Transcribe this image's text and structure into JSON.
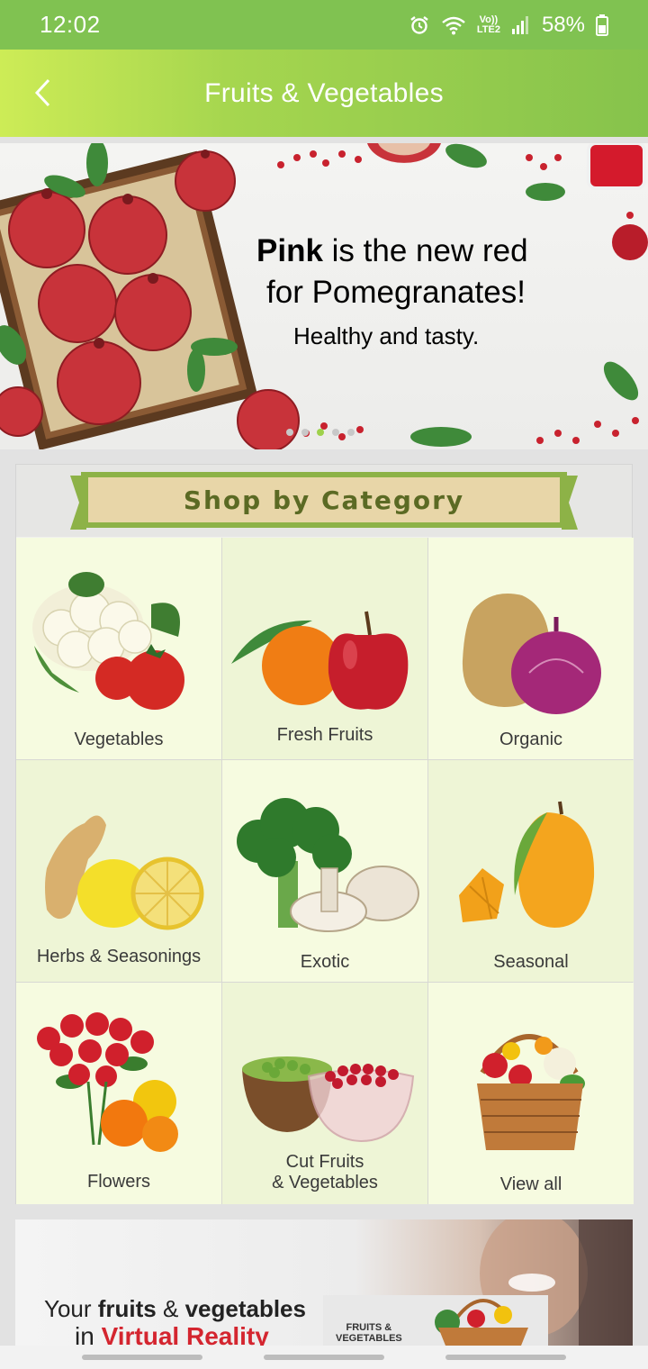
{
  "status_bar": {
    "time": "12:02",
    "network_label_top": "Vo))",
    "network_label_bottom": "LTE2",
    "battery": "58%",
    "icons": [
      "alarm-icon",
      "wifi-icon",
      "signal-icon",
      "battery-icon"
    ]
  },
  "app_bar": {
    "title": "Fruits & Vegetables",
    "back_icon": "chevron-left-icon"
  },
  "banner": {
    "line1_bold": "Pink",
    "line1_rest": " is the new red",
    "line2": "for Pomegranates!",
    "line3": "Healthy and tasty.",
    "slide_count": 5,
    "active_slide": 3
  },
  "category": {
    "heading": "Shop by Category",
    "items": [
      {
        "label": "Vegetables"
      },
      {
        "label": "Fresh Fruits"
      },
      {
        "label": "Organic"
      },
      {
        "label": "Herbs & Seasonings"
      },
      {
        "label": "Exotic"
      },
      {
        "label": "Seasonal"
      },
      {
        "label": "Flowers"
      },
      {
        "label_line1": "Cut Fruits",
        "label_line2": "& Vegetables"
      },
      {
        "label": "View all"
      }
    ]
  },
  "promo": {
    "line1_start": "Your ",
    "line1_bold1": "fruits",
    "line1_mid": " & ",
    "line1_bold2": "vegetables",
    "line2_start": "in ",
    "line2_highlight": "Virtual Reality",
    "badge_line1": "FRUITS &",
    "badge_line2": "VEGETABLES"
  },
  "colors": {
    "status_bar": "#80c251",
    "app_bar_start": "#cdec56",
    "app_bar_end": "#86c34c",
    "ribbon_fill": "#e8d6a8",
    "ribbon_border": "#8db247",
    "heading_text": "#5b6a24",
    "promo_highlight": "#d4252f"
  }
}
